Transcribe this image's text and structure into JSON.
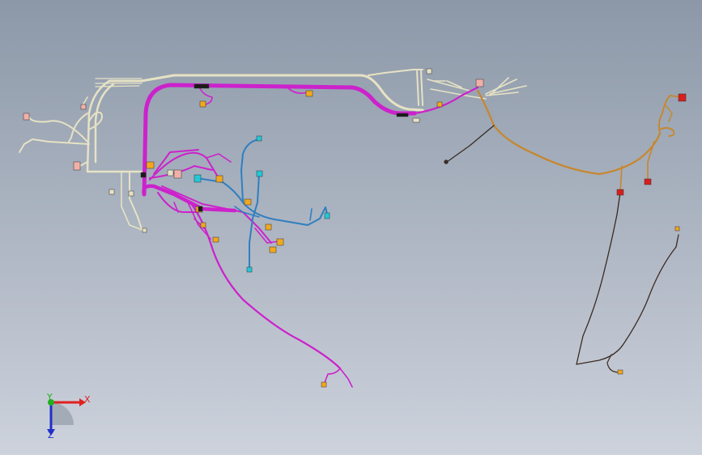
{
  "view": {
    "background_top": "#8c98a8",
    "background_bottom": "#cdd2dc"
  },
  "harness": {
    "colors": {
      "cream": "#e6e2c4",
      "magenta": "#cc22cc",
      "magenta_light": "#d04ad0",
      "blue": "#2f7fc0",
      "orange_brown": "#c8862a",
      "dark_brown": "#3a2a22",
      "connector_orange": "#f2a81e",
      "connector_pink": "#f0b0a8",
      "connector_cyan": "#22c8d8",
      "connector_red": "#d81e1e",
      "clip_black": "#1a1a1a"
    }
  },
  "triad": {
    "x_label": "X",
    "y_label": "Y",
    "z_label": "Z",
    "x_color": "#e02020",
    "y_color": "#20b020",
    "z_color": "#2030c8"
  }
}
